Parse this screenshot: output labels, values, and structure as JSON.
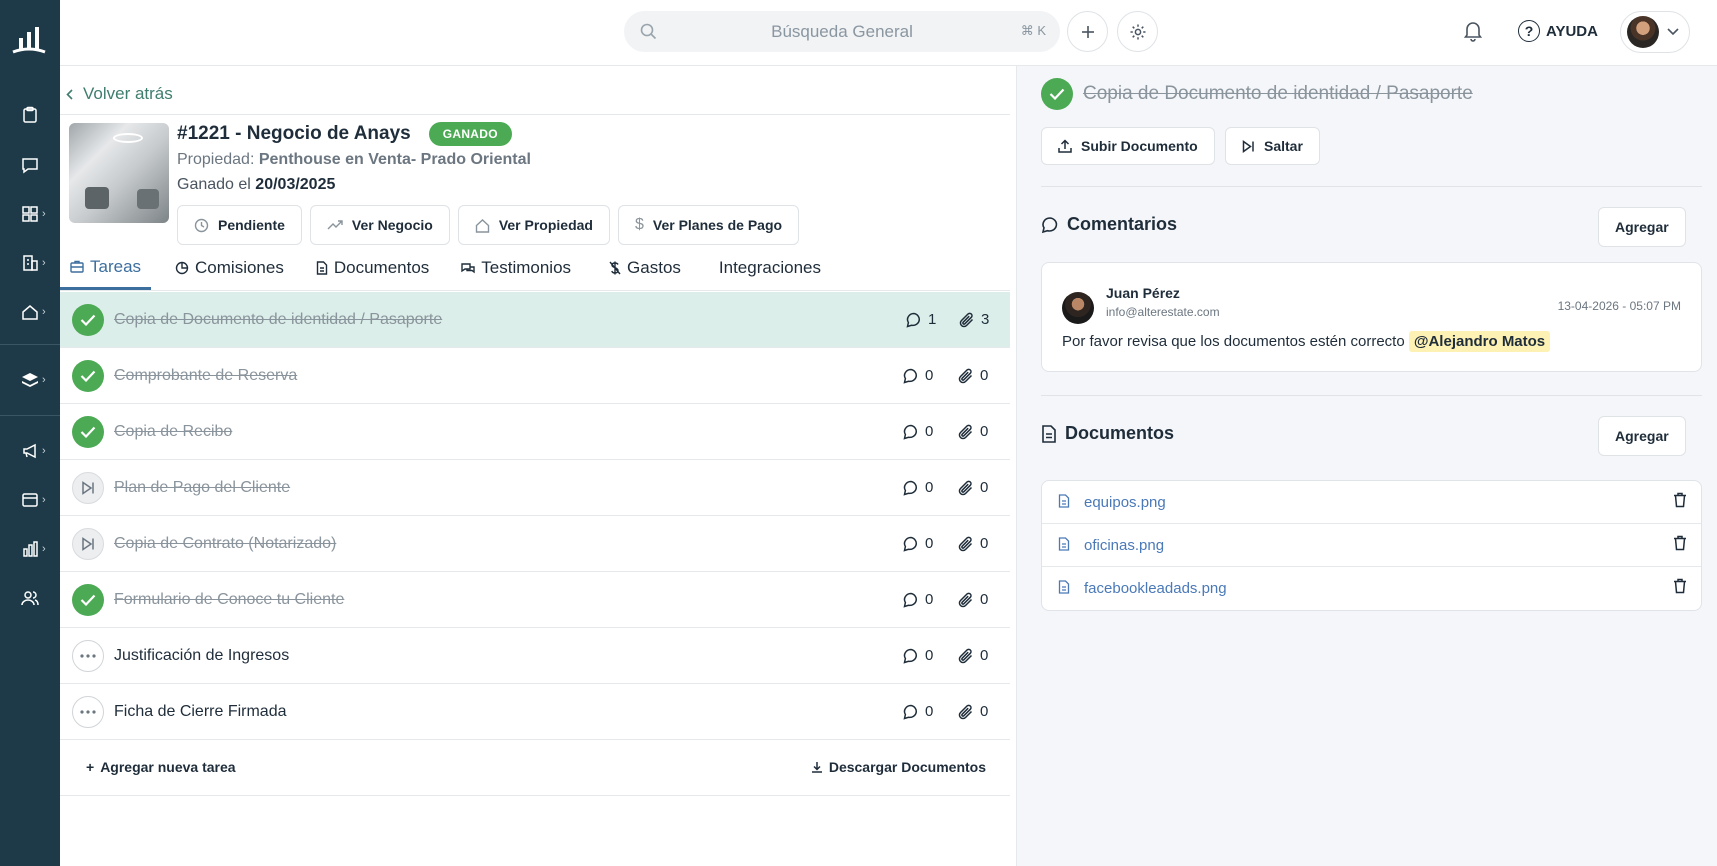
{
  "topbar": {
    "search_placeholder": "Búsqueda General",
    "search_shortcut": "⌘ K",
    "help_label": "AYUDA"
  },
  "deal": {
    "back_label": "Volver atrás",
    "title": "#1221 - Negocio de Anays",
    "status_badge": "GANADO",
    "property_prefix": "Propiedad:",
    "property_name": "Penthouse en Venta- Prado Oriental",
    "won_prefix": "Ganado el",
    "won_date": "20/03/2025",
    "actions": [
      "Pendiente",
      "Ver Negocio",
      "Ver Propiedad",
      "Ver Planes de Pago"
    ]
  },
  "tabs": [
    {
      "label": "Tareas",
      "active": true
    },
    {
      "label": "Comisiones"
    },
    {
      "label": "Documentos"
    },
    {
      "label": "Testimonios"
    },
    {
      "label": "Gastos"
    },
    {
      "label": "Integraciones"
    }
  ],
  "tasks": [
    {
      "name": "Copia de Documento de identidad / Pasaporte",
      "status": "done",
      "comments": "1",
      "attachments": "3",
      "selected": true
    },
    {
      "name": "Comprobante de Reserva",
      "status": "done",
      "comments": "0",
      "attachments": "0"
    },
    {
      "name": "Copia de Recibo",
      "status": "done",
      "comments": "0",
      "attachments": "0"
    },
    {
      "name": "Plan de Pago del Cliente",
      "status": "skipped",
      "comments": "0",
      "attachments": "0"
    },
    {
      "name": "Copia de Contrato (Notarizado)",
      "status": "skipped",
      "comments": "0",
      "attachments": "0"
    },
    {
      "name": "Formulario de Conoce tu Cliente",
      "status": "done",
      "comments": "0",
      "attachments": "0"
    },
    {
      "name": "Justificación de Ingresos",
      "status": "pending",
      "comments": "0",
      "attachments": "0"
    },
    {
      "name": "Ficha de Cierre Firmada",
      "status": "pending",
      "comments": "0",
      "attachments": "0"
    }
  ],
  "task_footer": {
    "add_label": "Agregar nueva tarea",
    "download_label": "Descargar Documentos"
  },
  "detail": {
    "title": "Copia de Documento de identidad / Pasaporte",
    "upload_label": "Subir Documento",
    "skip_label": "Saltar",
    "comments_title": "Comentarios",
    "comments_add": "Agregar",
    "comment": {
      "author": "Juan Pérez",
      "email": "info@alterestate.com",
      "date": "13-04-2026 - 05:07 PM",
      "text": "Por favor revisa que los documentos estén correcto",
      "mention": "@Alejandro Matos"
    },
    "documents_title": "Documentos",
    "documents_add": "Agregar",
    "documents": [
      "equipos.png",
      "oficinas.png",
      "facebookleadads.png"
    ]
  },
  "colors": {
    "sidebar": "#1e3a48",
    "success": "#4caa54",
    "accent": "#3d6f9e",
    "selected_row": "#dceee9",
    "link": "#4a79b8"
  }
}
